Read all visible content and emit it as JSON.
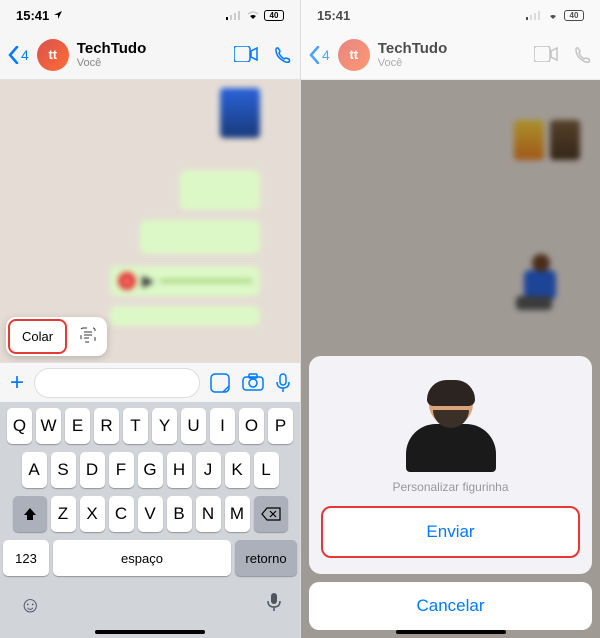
{
  "status": {
    "time": "15:41",
    "battery": "40"
  },
  "header": {
    "back_count": "4",
    "contact_name": "TechTudo",
    "contact_status": "Você",
    "avatar_text": "tt"
  },
  "paste_menu": {
    "paste": "Colar"
  },
  "keyboard": {
    "row1": [
      "Q",
      "W",
      "E",
      "R",
      "T",
      "Y",
      "U",
      "I",
      "O",
      "P"
    ],
    "row2": [
      "A",
      "S",
      "D",
      "F",
      "G",
      "H",
      "J",
      "K",
      "L"
    ],
    "row3": [
      "Z",
      "X",
      "C",
      "V",
      "B",
      "N",
      "M"
    ],
    "num": "123",
    "space": "espaço",
    "return": "retorno"
  },
  "sheet": {
    "personalize": "Personalizar figurinha",
    "send": "Enviar",
    "cancel": "Cancelar"
  }
}
